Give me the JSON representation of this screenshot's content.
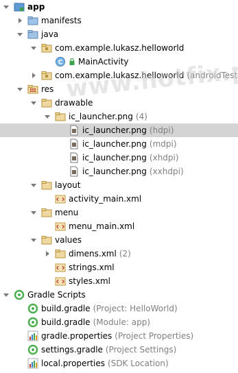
{
  "watermark": "www.hotfix.pl",
  "colors": {
    "selection": "#d4d4d4",
    "folder": "#c8a050",
    "hint": "#808080",
    "gradle": "#4caf50"
  },
  "tree": [
    {
      "label": "app",
      "hint": "",
      "icon": "module-folder-icon",
      "arrow": "down",
      "bold": true
    },
    {
      "label": "manifests",
      "hint": "",
      "icon": "folder-icon",
      "arrow": "right"
    },
    {
      "label": "java",
      "hint": "",
      "icon": "folder-icon",
      "arrow": "down"
    },
    {
      "label": "com.example.lukasz.helloworld",
      "hint": "",
      "icon": "package-icon",
      "arrow": "down"
    },
    {
      "label": "MainActivity",
      "hint": "",
      "icon": "class-icon",
      "arrow": "none"
    },
    {
      "label": "com.example.lukasz.helloworld",
      "hint": "(androidTest)",
      "icon": "package-icon",
      "arrow": "right"
    },
    {
      "label": "res",
      "hint": "",
      "icon": "res-folder-icon",
      "arrow": "down"
    },
    {
      "label": "drawable",
      "hint": "",
      "icon": "folder-icon",
      "arrow": "down"
    },
    {
      "label": "ic_launcher.png",
      "hint": "(4)",
      "icon": "folder-icon",
      "arrow": "down"
    },
    {
      "label": "ic_launcher.png",
      "hint": "(hdpi)",
      "icon": "image-file-icon",
      "arrow": "none",
      "selected": true
    },
    {
      "label": "ic_launcher.png",
      "hint": "(mdpi)",
      "icon": "image-file-icon",
      "arrow": "none"
    },
    {
      "label": "ic_launcher.png",
      "hint": "(xhdpi)",
      "icon": "image-file-icon",
      "arrow": "none"
    },
    {
      "label": "ic_launcher.png",
      "hint": "(xxhdpi)",
      "icon": "image-file-icon",
      "arrow": "none"
    },
    {
      "label": "layout",
      "hint": "",
      "icon": "folder-icon",
      "arrow": "down"
    },
    {
      "label": "activity_main.xml",
      "hint": "",
      "icon": "xml-file-icon",
      "arrow": "none"
    },
    {
      "label": "menu",
      "hint": "",
      "icon": "folder-icon",
      "arrow": "down"
    },
    {
      "label": "menu_main.xml",
      "hint": "",
      "icon": "xml-file-icon",
      "arrow": "none"
    },
    {
      "label": "values",
      "hint": "",
      "icon": "folder-icon",
      "arrow": "down"
    },
    {
      "label": "dimens.xml",
      "hint": "(2)",
      "icon": "folder-icon",
      "arrow": "right"
    },
    {
      "label": "strings.xml",
      "hint": "",
      "icon": "xml-file-icon",
      "arrow": "none"
    },
    {
      "label": "styles.xml",
      "hint": "",
      "icon": "xml-file-icon",
      "arrow": "none"
    },
    {
      "label": "Gradle Scripts",
      "hint": "",
      "icon": "gradle-scripts-icon",
      "arrow": "down"
    },
    {
      "label": "build.gradle",
      "hint": "(Project: HelloWorld)",
      "icon": "gradle-file-icon",
      "arrow": "none"
    },
    {
      "label": "build.gradle",
      "hint": "(Module: app)",
      "icon": "gradle-file-icon",
      "arrow": "none"
    },
    {
      "label": "gradle.properties",
      "hint": "(Project Properties)",
      "icon": "properties-file-icon",
      "arrow": "none"
    },
    {
      "label": "settings.gradle",
      "hint": "(Project Settings)",
      "icon": "gradle-file-icon",
      "arrow": "none"
    },
    {
      "label": "local.properties",
      "hint": "(SDK Location)",
      "icon": "properties-file-icon",
      "arrow": "none"
    }
  ]
}
